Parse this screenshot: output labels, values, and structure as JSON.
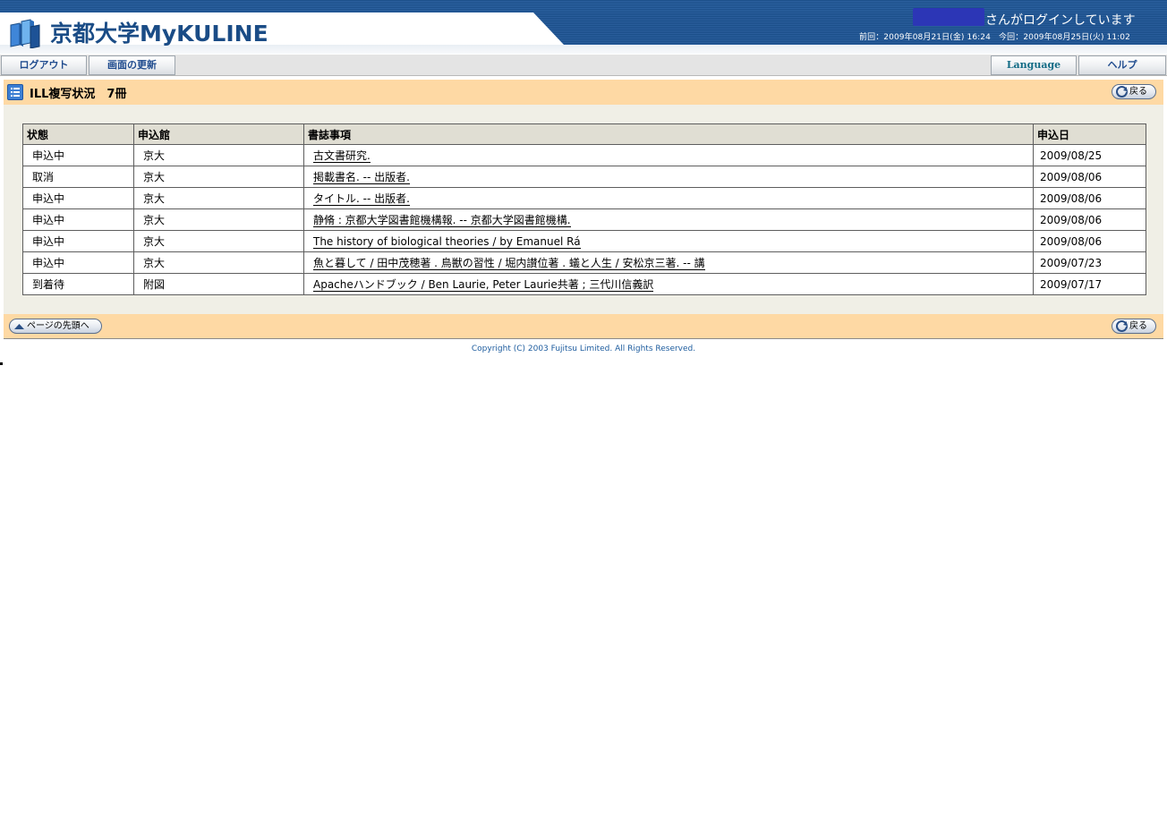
{
  "header": {
    "app_title": "京都大学MyKULINE",
    "login_status": "さんがログインしています",
    "login_times": "前回：2009年08月21日(金) 16:24　今回：2009年08月25日(火) 11:02",
    "logo_icon": "books-icon",
    "colors": {
      "brand_blue": "#1a4c86",
      "header_band": "#1b4f8a"
    }
  },
  "toolbar": {
    "logout_label": "ログアウト",
    "refresh_label": "画面の更新",
    "language_label": "Language",
    "help_label": "ヘルプ"
  },
  "section": {
    "title": "ILL複写状況　7冊",
    "icon": "list-icon",
    "back_label": "戻る",
    "page_top_label": "ページの先頭へ",
    "colors": {
      "title_bar": "#fed9a4",
      "panel": "#f0efe6",
      "table_header": "#e0ded3"
    }
  },
  "table": {
    "headers": [
      "状態",
      "申込館",
      "書誌事項",
      "申込日"
    ],
    "rows": [
      {
        "status": "申込中",
        "library": "京大",
        "bib": "古文書研究.",
        "date": "2009/08/25"
      },
      {
        "status": "取消",
        "library": "京大",
        "bib": "掲載書名. -- 出版者.",
        "date": "2009/08/06"
      },
      {
        "status": "申込中",
        "library": "京大",
        "bib": "タイトル. -- 出版者.",
        "date": "2009/08/06"
      },
      {
        "status": "申込中",
        "library": "京大",
        "bib": "静脩 : 京都大学図書館機構報. -- 京都大学図書館機構.",
        "date": "2009/08/06"
      },
      {
        "status": "申込中",
        "library": "京大",
        "bib": "The history of biological theories / by Emanuel Rá",
        "date": "2009/08/06"
      },
      {
        "status": "申込中",
        "library": "京大",
        "bib": "魚と暮して / 田中茂穂著 . 鳥獣の習性 / 堀内讃位著 . 蟻と人生 / 安松京三著. -- 講",
        "date": "2009/07/23"
      },
      {
        "status": "到着待",
        "library": "附図",
        "bib": "Apacheハンドブック / Ben Laurie, Peter Laurie共著 ; 三代川信義訳",
        "date": "2009/07/17"
      }
    ]
  },
  "footer": {
    "copyright": "Copyright (C) 2003 Fujitsu Limited. All Rights Reserved."
  }
}
